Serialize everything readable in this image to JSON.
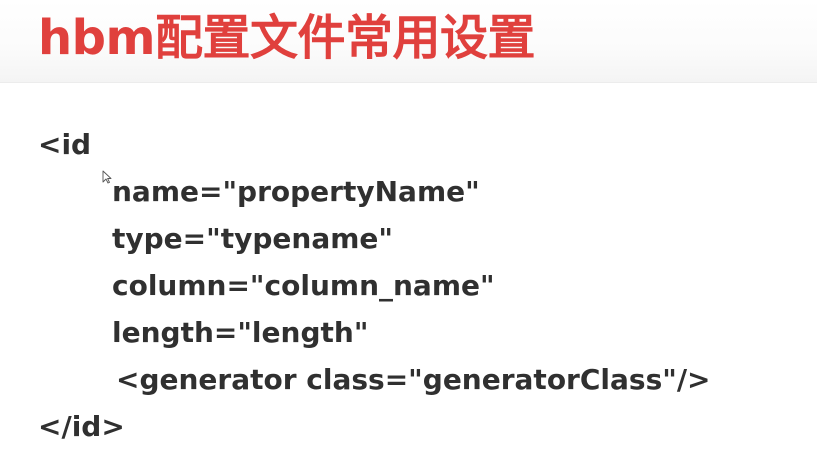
{
  "slide": {
    "title": "hbm配置文件常用设置",
    "title_color": "#e0403d",
    "code_lines": [
      "<id",
      "name=\"propertyName\"",
      "type=\"typename\"",
      "column=\"column_name\"",
      "length=\"length\"",
      "<generator class=\"generatorClass\"/>",
      "</id>"
    ]
  },
  "icons": {
    "cursor": "mouse-pointer-icon"
  }
}
